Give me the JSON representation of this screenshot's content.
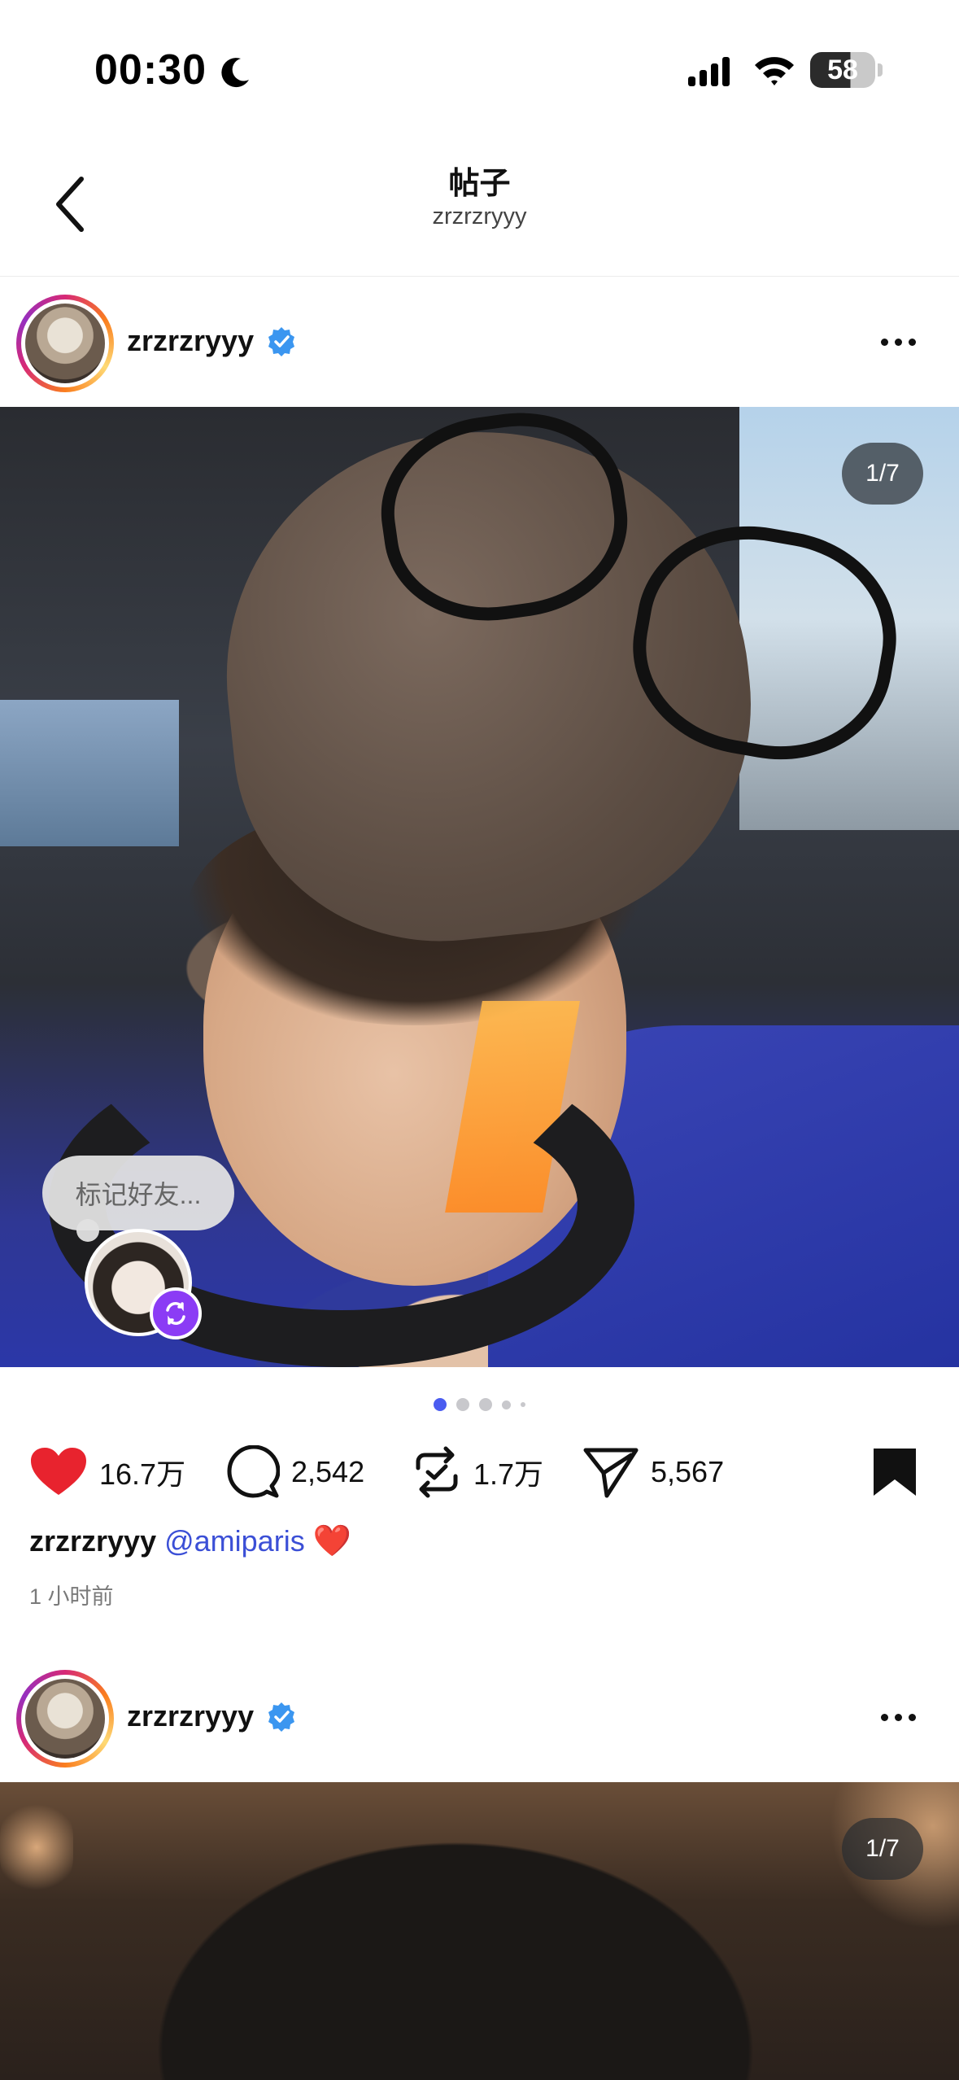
{
  "status_bar": {
    "time": "00:30",
    "battery": "58"
  },
  "header": {
    "title": "帖子",
    "subtitle": "zrzrzryyy"
  },
  "posts": [
    {
      "username": "zrzrzryyy",
      "photo_counter": "1/7",
      "tag_prompt": "标记好友...",
      "pagination": {
        "total_dots": 5,
        "active_index": 0
      },
      "actions": {
        "likes": "16.7万",
        "comments": "2,542",
        "reposts": "1.7万",
        "shares": "5,567"
      },
      "caption": {
        "user": "zrzrzryyy",
        "mention": "@amiparis",
        "emoji": "❤️"
      },
      "time_ago": "1 小时前"
    },
    {
      "username": "zrzrzryyy",
      "photo_counter": "1/7"
    }
  ],
  "colors": {
    "like": "#e8232e",
    "mention": "#3b4fd6",
    "verified": "#3b96f0",
    "active_dot": "#4a5cf0",
    "repost_badge": "#8b3cf5"
  }
}
